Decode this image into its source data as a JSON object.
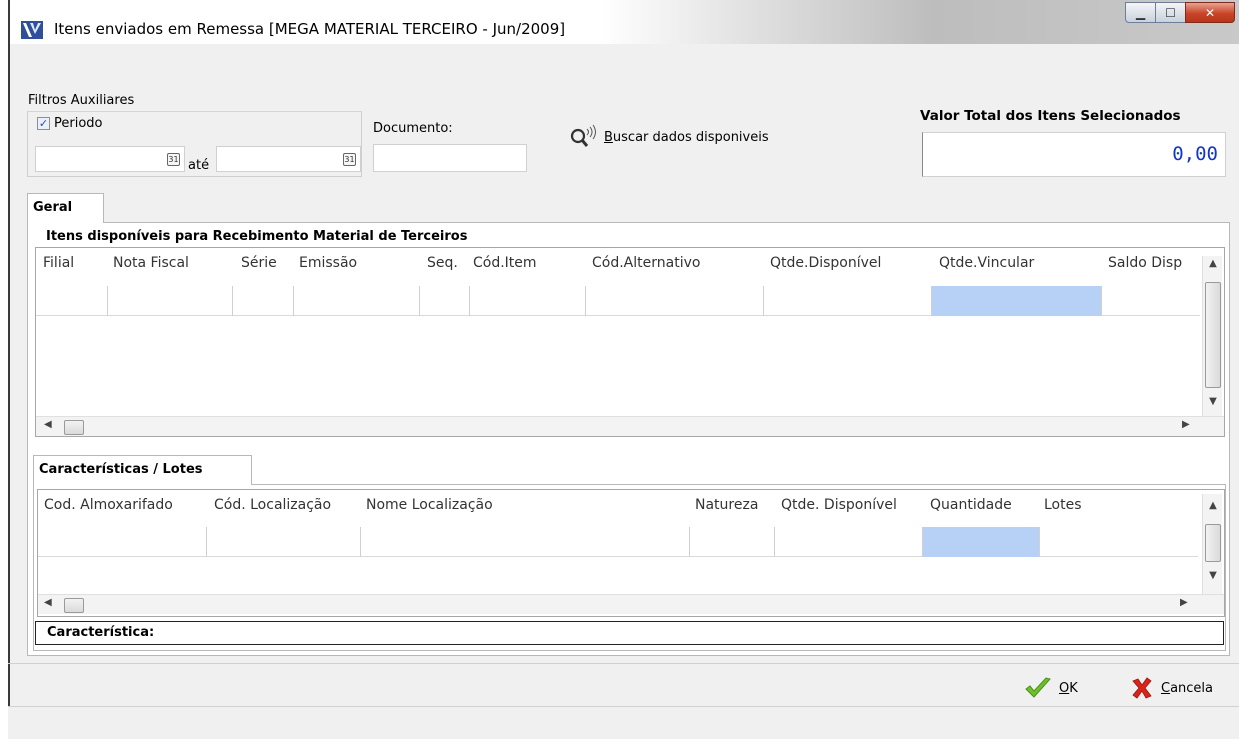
{
  "window": {
    "title": "Itens enviados em Remessa [MEGA MATERIAL TERCEIRO - Jun/2009]",
    "controls": [
      "minimize",
      "maximize",
      "close"
    ]
  },
  "filters": {
    "group_label": "Filtros Auxiliares",
    "periodo_label": "Periodo",
    "periodo_checked": true,
    "date_from": "",
    "date_to": "",
    "ate_label": "até",
    "documento_label": "Documento:",
    "documento_value": ""
  },
  "search": {
    "label_underline": "B",
    "label_rest": "uscar dados disponiveis",
    "icon": "search-icon"
  },
  "total": {
    "label": "Valor Total dos Itens Selecionados",
    "value": "0,00"
  },
  "tabs": {
    "main": "Geral",
    "secondary": "Características / Lotes"
  },
  "items_grid": {
    "section_label": "Itens disponíveis para Recebimento Material de Terceiros",
    "columns": [
      "Filial",
      "Nota Fiscal",
      "Série",
      "Emissão",
      "Seq.",
      "Cód.Item",
      "Cód.Alternativo",
      "Qtde.Disponível",
      "Qtde.Vincular",
      "Saldo Disp"
    ],
    "highlight_column": "Qtde.Vincular",
    "rows": []
  },
  "lotes_grid": {
    "columns": [
      "Cod. Almoxarifado",
      "Cód. Localização",
      "Nome Localização",
      "Natureza",
      "Qtde. Disponível",
      "Quantidade",
      "Lotes"
    ],
    "highlight_column": "Quantidade",
    "rows": []
  },
  "caracteristica": {
    "label": "Característica:",
    "value": ""
  },
  "buttons": {
    "ok_underline": "O",
    "ok_rest": "K",
    "cancel_underline": "C",
    "cancel_rest": "ancela"
  },
  "colors": {
    "accent": "#1436c8",
    "highlight_cell": "#b6d1f5",
    "ok_check": "#6fbf2a",
    "cancel_x": "#d8241a"
  }
}
